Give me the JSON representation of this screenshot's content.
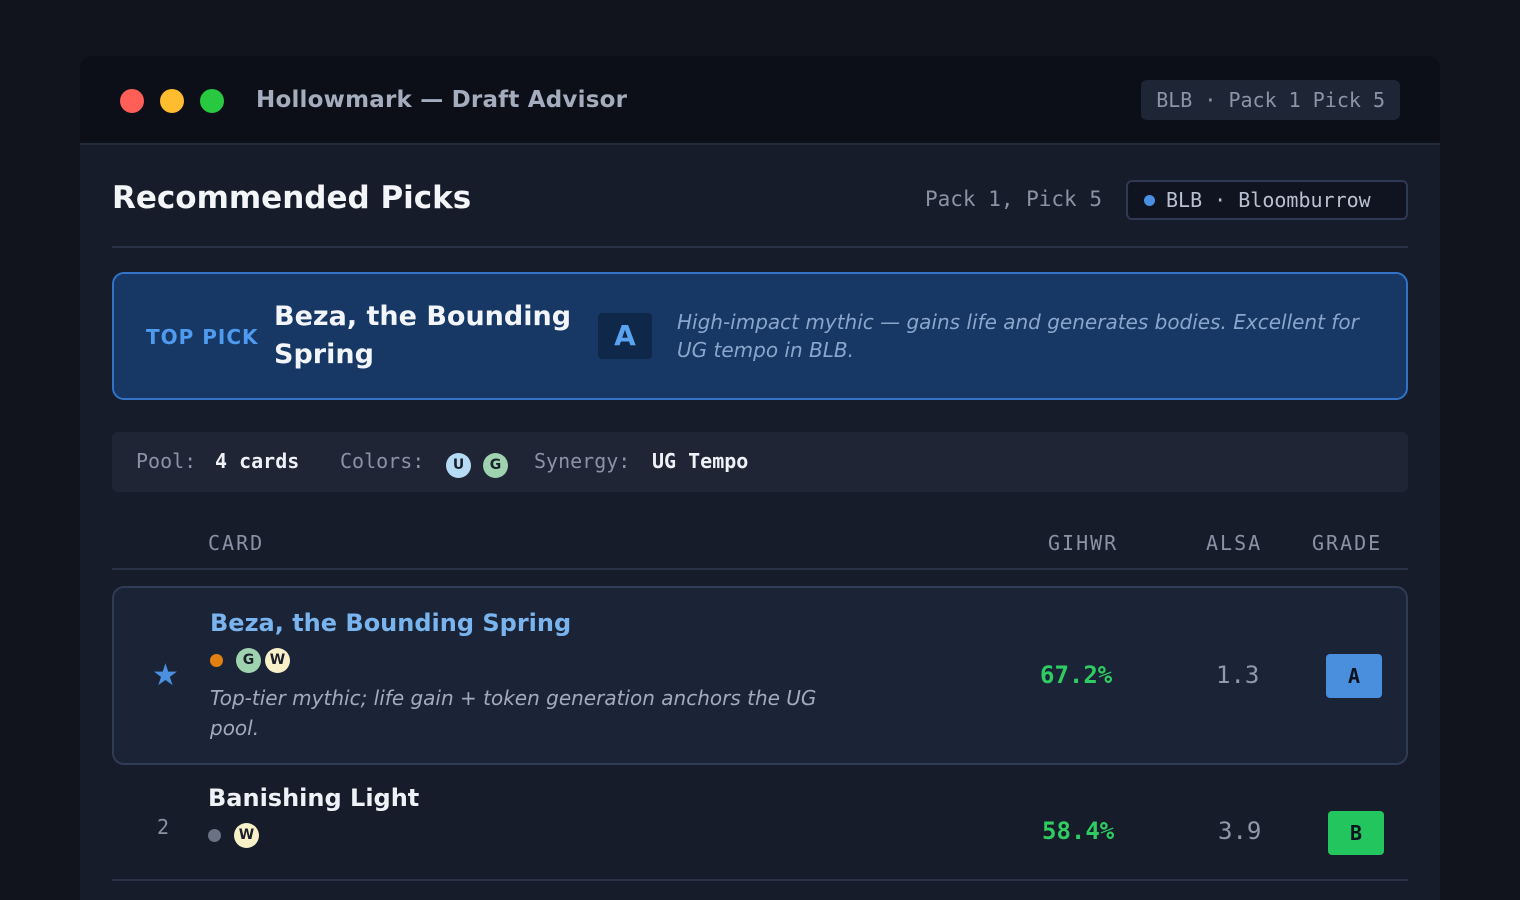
{
  "window": {
    "title": "Hollowmark — Draft Advisor",
    "session_chip": "BLB · Pack 1 Pick 5"
  },
  "header": {
    "title": "Recommended Picks",
    "pack_pick": "Pack 1, Pick 5",
    "set_chip": "BLB · Bloomburrow",
    "set_dot_color": "#4a90e2"
  },
  "top_pick": {
    "label": "TOP PICK",
    "card_name": "Beza, the Bounding Spring",
    "grade": "A",
    "note": "High-impact mythic — gains life and generates bodies. Excellent for UG tempo in BLB."
  },
  "pool": {
    "pool_label": "Pool:",
    "pool_value": "4 cards",
    "colors_label": "Colors:",
    "colors": [
      "U",
      "G"
    ],
    "synergy_label": "Synergy:",
    "synergy_value": "UG Tempo"
  },
  "table": {
    "headers": {
      "card": "CARD",
      "gihwr": "GIHWR",
      "alsa": "ALSA",
      "grade": "GRADE"
    },
    "rows": [
      {
        "rank": "",
        "icon": "star-icon",
        "name": "Beza, the Bounding Spring",
        "rarity": "mythic",
        "mana": [
          "G",
          "W"
        ],
        "note": "Top-tier mythic; life gain + token generation anchors the UG pool.",
        "gihwr": "67.2%",
        "alsa": "1.3",
        "grade": "A"
      },
      {
        "rank": "2",
        "name": "Banishing Light",
        "rarity": "common",
        "mana": [
          "W"
        ],
        "gihwr": "58.4%",
        "alsa": "3.9",
        "grade": "B"
      }
    ]
  },
  "colors": {
    "accent": "#4a8fde",
    "winrate": "#2fcc62",
    "grade_a": "#4a8fde",
    "grade_b": "#22c55e",
    "mythic": "#e38012"
  }
}
